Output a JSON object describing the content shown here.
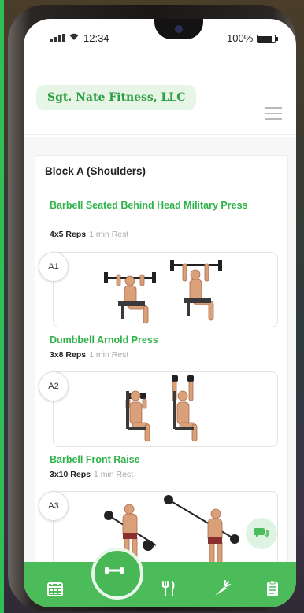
{
  "status_bar": {
    "time": "12:34",
    "battery": "100%"
  },
  "header": {
    "brand": "Sgt. Nate Fitness, LLC"
  },
  "block": {
    "title": "Block A (Shoulders)"
  },
  "exercises": [
    {
      "code": "A1",
      "title": "Barbell Seated Behind Head Military Press",
      "reps": "4x5 Reps",
      "rest": "1 min Rest"
    },
    {
      "code": "A2",
      "title": "Dumbbell Arnold Press",
      "reps": "3x8 Reps",
      "rest": "1 min Rest"
    },
    {
      "code": "A3",
      "title": "Barbell Front Raise",
      "reps": "3x10 Reps",
      "rest": "1 min Rest"
    }
  ],
  "nav": {
    "items": [
      {
        "icon": "calendar-icon"
      },
      {
        "icon": "dumbbell-icon",
        "active": true
      },
      {
        "icon": "utensils-icon"
      },
      {
        "icon": "carrot-icon"
      },
      {
        "icon": "clipboard-icon"
      }
    ]
  },
  "colors": {
    "accent": "#2fb348",
    "tabbar": "#4cbb5a",
    "brand_bg": "#e6f5e6"
  }
}
